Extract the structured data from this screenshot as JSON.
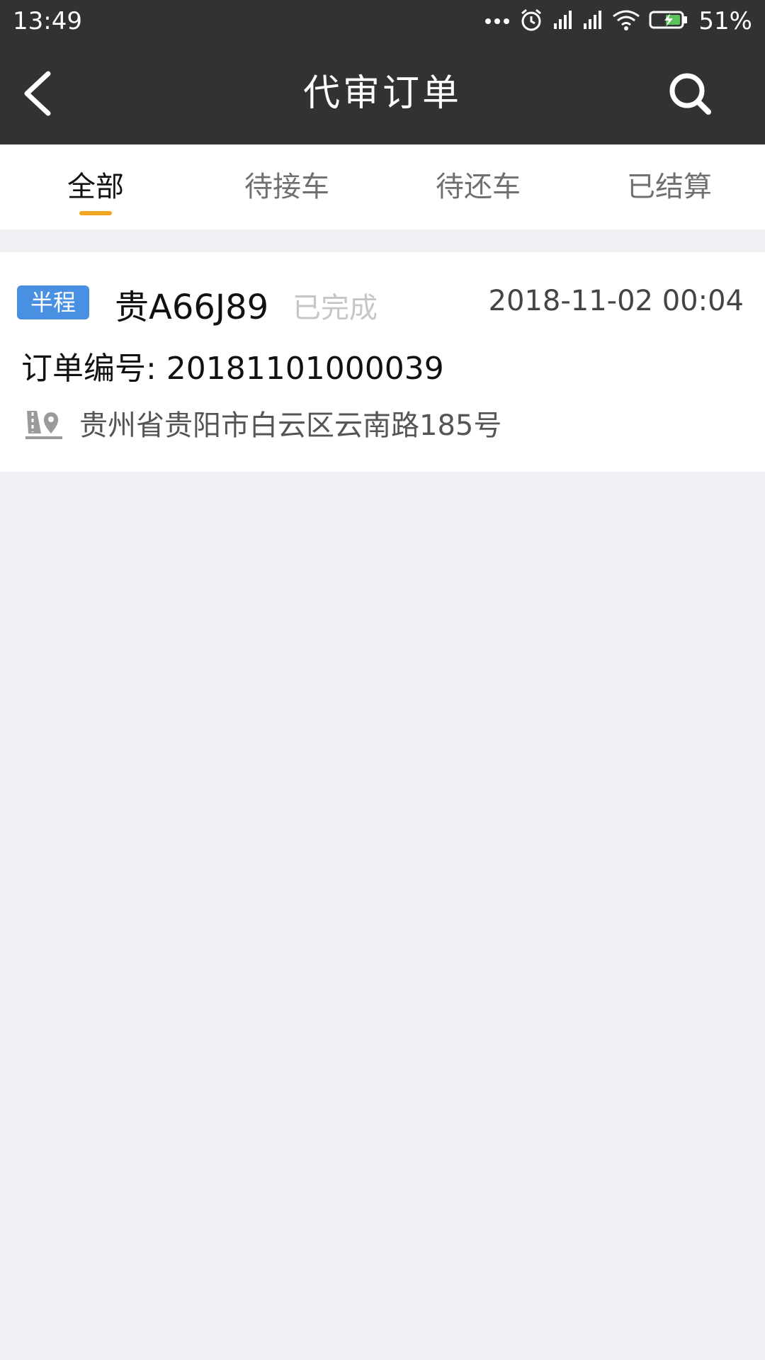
{
  "status_bar": {
    "time": "13:49",
    "battery_percent": "51%"
  },
  "header": {
    "title": "代审订单",
    "back_icon": "chevron-left-icon",
    "search_icon": "search-icon"
  },
  "tabs": [
    {
      "label": "全部",
      "active": true
    },
    {
      "label": "待接车",
      "active": false
    },
    {
      "label": "待还车",
      "active": false
    },
    {
      "label": "已结算",
      "active": false
    }
  ],
  "orders": [
    {
      "type_badge": "半程",
      "plate": "贵A66J89",
      "status": "已完成",
      "time": "2018-11-02 00:04",
      "order_no": "订单编号: 20181101000039",
      "address": "贵州省贵阳市白云区云南路185号"
    }
  ],
  "colors": {
    "header_bg": "#323232",
    "tab_indicator": "#f0a523",
    "badge_bg": "#4a90e2",
    "page_bg": "#efeff4"
  }
}
